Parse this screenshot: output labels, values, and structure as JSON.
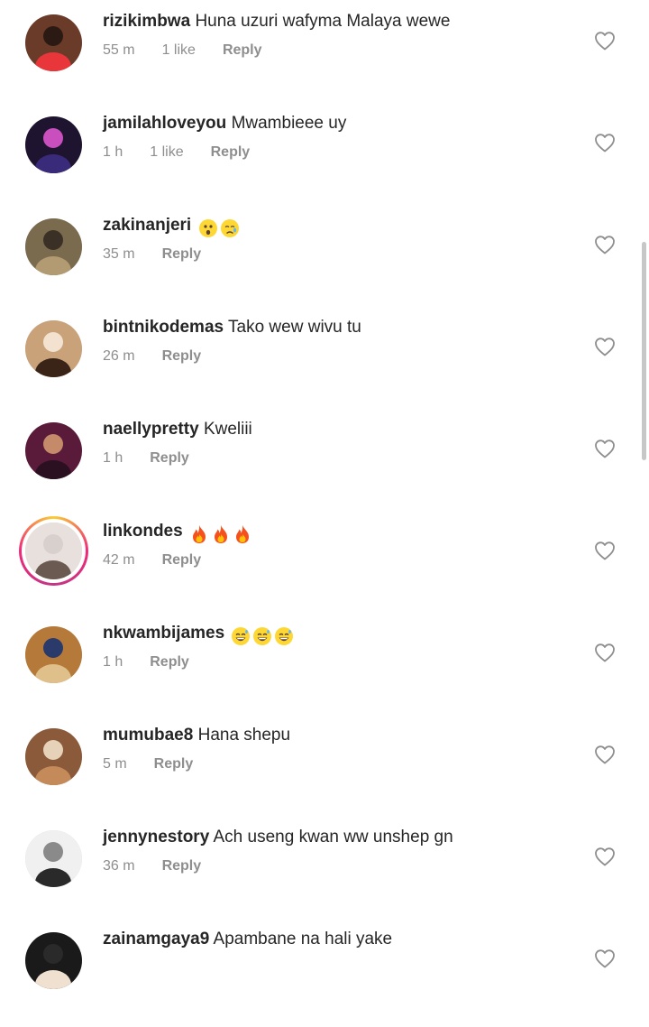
{
  "comments": [
    {
      "username": "rizikimbwa",
      "text": "Huna uzuri wafyma Malaya wewe",
      "time": "55 m",
      "likes": "1 like",
      "reply": "Reply",
      "emojis": []
    },
    {
      "username": "jamilahloveyou",
      "text": "Mwambieee uy",
      "time": "1 h",
      "likes": "1 like",
      "reply": "Reply",
      "emojis": []
    },
    {
      "username": "zakinanjeri",
      "text": "",
      "time": "35 m",
      "likes": "",
      "reply": "Reply",
      "emojis": [
        "astonished-face",
        "crying-face"
      ]
    },
    {
      "username": "bintnikodemas",
      "text": "Tako wew wivu tu",
      "time": "26 m",
      "likes": "",
      "reply": "Reply",
      "emojis": []
    },
    {
      "username": "naellypretty",
      "text": "Kweliii",
      "time": "1 h",
      "likes": "",
      "reply": "Reply",
      "emojis": []
    },
    {
      "username": "linkondes",
      "text": "",
      "time": "42 m",
      "likes": "",
      "reply": "Reply",
      "emojis": [
        "fire",
        "fire",
        "fire"
      ],
      "has_story": true
    },
    {
      "username": "nkwambijames",
      "text": "",
      "time": "1 h",
      "likes": "",
      "reply": "Reply",
      "emojis": [
        "grinning-sweat",
        "grinning-sweat",
        "grinning-sweat"
      ]
    },
    {
      "username": "mumubae8",
      "text": "Hana shepu",
      "time": "5 m",
      "likes": "",
      "reply": "Reply",
      "emojis": []
    },
    {
      "username": "jennynestory",
      "text": "Ach useng kwan ww unshep gn",
      "time": "36 m",
      "likes": "",
      "reply": "Reply",
      "emojis": []
    },
    {
      "username": "zainamgaya9",
      "text": "Apambane na hali yake",
      "time": "",
      "likes": "",
      "reply": "",
      "emojis": []
    }
  ],
  "icons": {
    "like": "heart-outline-icon"
  },
  "colors": {
    "text": "#262626",
    "meta": "#8e8e8e",
    "background": "#ffffff"
  }
}
